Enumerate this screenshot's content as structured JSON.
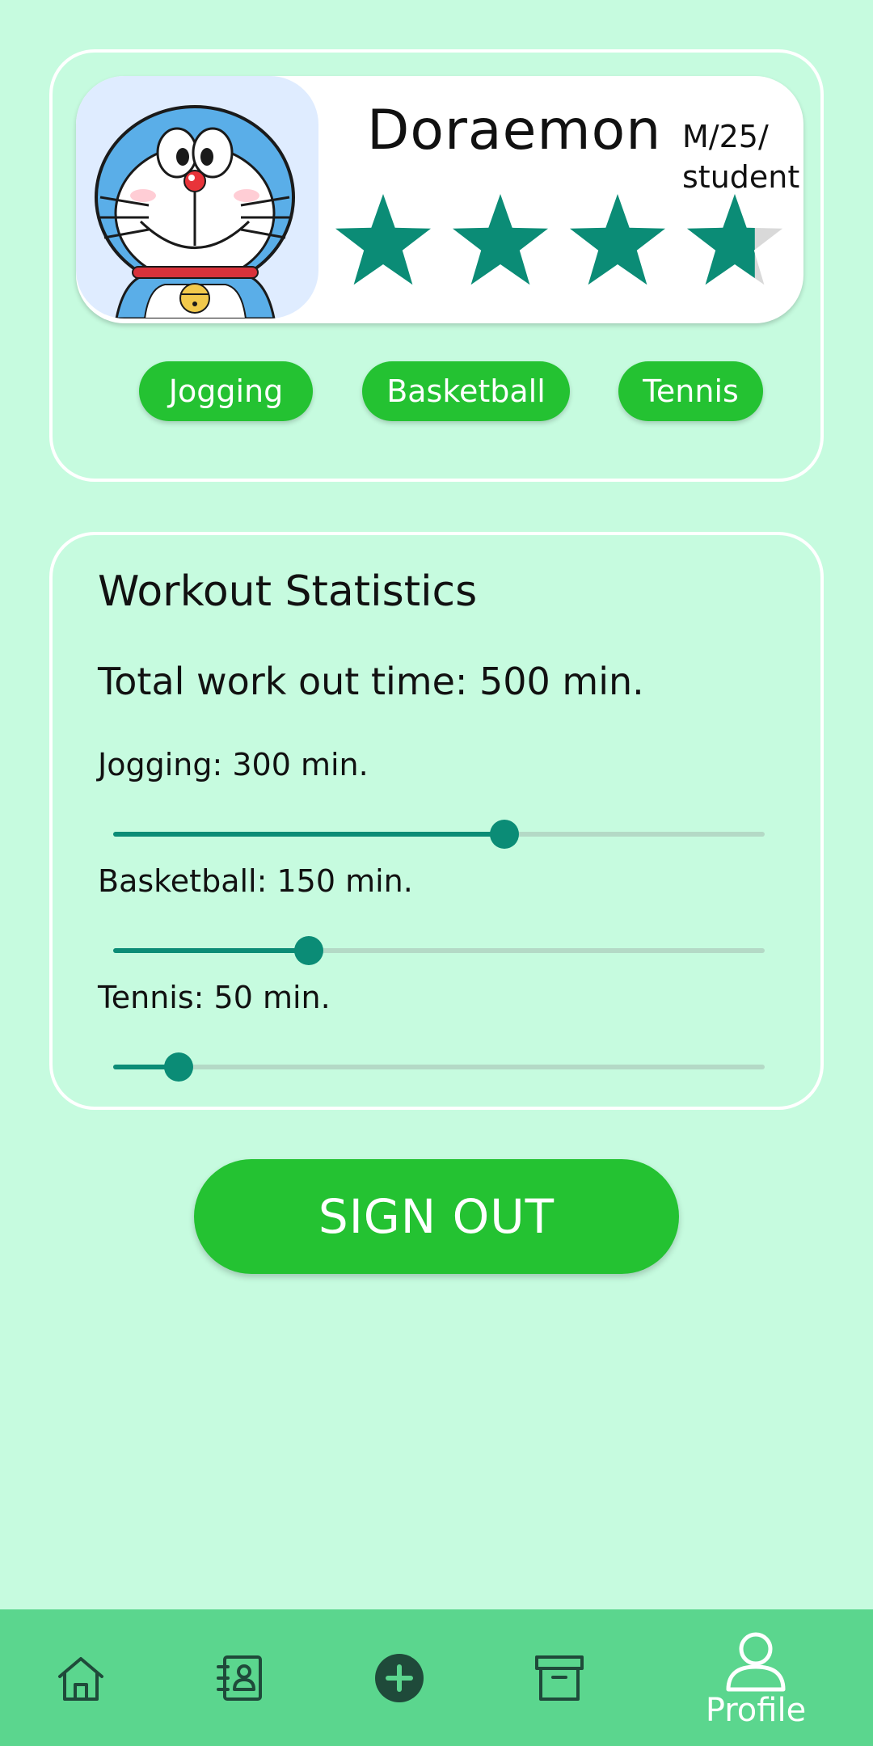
{
  "profile": {
    "name": "Doraemon",
    "meta_line1": "M/25/",
    "meta_line2": "student",
    "rating": 3.7,
    "rating_max": 5,
    "tags": [
      "Jogging",
      "Basketball",
      "Tennis"
    ]
  },
  "stats": {
    "title": "Workout Statistics",
    "total": "Total work out time: 500 min.",
    "items": [
      {
        "label": "Jogging: 300 min.",
        "value": 0.6
      },
      {
        "label": "Basketball: 150 min.",
        "value": 0.3
      },
      {
        "label": "Tennis: 50 min.",
        "value": 0.1
      }
    ]
  },
  "signout_label": "SIGN OUT",
  "nav": {
    "items": [
      {
        "icon": "home-icon"
      },
      {
        "icon": "contacts-icon"
      },
      {
        "icon": "add-circle-icon"
      },
      {
        "icon": "archive-icon"
      },
      {
        "icon": "profile-icon",
        "label": "Profile",
        "active": true
      }
    ]
  },
  "colors": {
    "background": "#c6fbdf",
    "accent_green": "#24c232",
    "teal": "#0b8c76",
    "nav_bar": "#5bd68e",
    "nav_icon": "#1f4a3a"
  }
}
